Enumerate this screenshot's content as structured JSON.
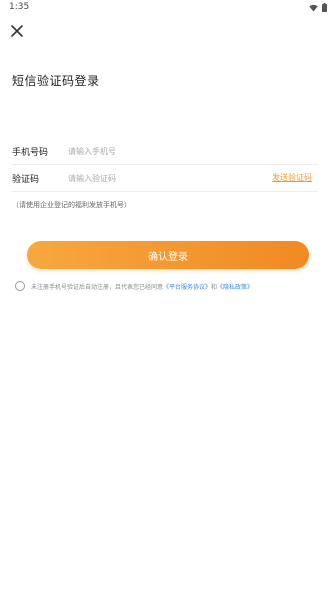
{
  "status": {
    "time": "1:35"
  },
  "title": "短信验证码登录",
  "phone": {
    "label": "手机号码",
    "placeholder": "请输入手机号",
    "value": ""
  },
  "code": {
    "label": "验证码",
    "placeholder": "请输入验证码",
    "value": "",
    "send_label": "发送验证码"
  },
  "hint": "（请使用企业登记的福利发放手机号）",
  "confirm_label": "确认登录",
  "agreement": {
    "prefix": "未注册手机号验证后自动注册，且代表您已经同意",
    "service_link": "《平台服务协议》",
    "conjunction": "和",
    "privacy_link": "《隐私政策》",
    "checked": false
  },
  "colors": {
    "accent": "#f18a22",
    "link": "#3b8cf0"
  }
}
